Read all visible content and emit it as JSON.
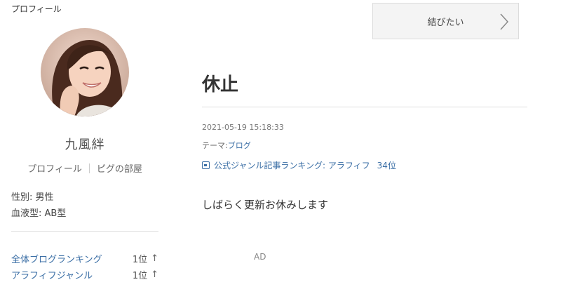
{
  "sidebar": {
    "section_label": "プロフィール",
    "name": "九風絆",
    "links": {
      "profile": "プロフィール",
      "room": "ピグの部屋"
    },
    "gender": "性別: 男性",
    "blood_type": "血液型: AB型",
    "rankings": [
      {
        "label": "全体ブログランキング",
        "value": "1位",
        "trend_icon": "arrow-up-icon"
      },
      {
        "label": "アラフィフジャンル",
        "value": "1位",
        "trend_icon": "arrow-up-icon"
      }
    ]
  },
  "follow_button": {
    "label": "結びたい",
    "icon": "chevron-right-icon"
  },
  "post": {
    "title": "休止",
    "date": "2021-05-19 15:18:33",
    "theme_prefix": "テーマ:",
    "theme": "ブログ",
    "ranking_text": "公式ジャンル記事ランキング: アラフィフ",
    "ranking_rank": "34位",
    "body": "しばらく更新お休みします"
  },
  "ad_label": "AD",
  "colors": {
    "link": "#3a6ea5",
    "button_bg": "#f4f4f4",
    "divider": "#dddddd"
  }
}
